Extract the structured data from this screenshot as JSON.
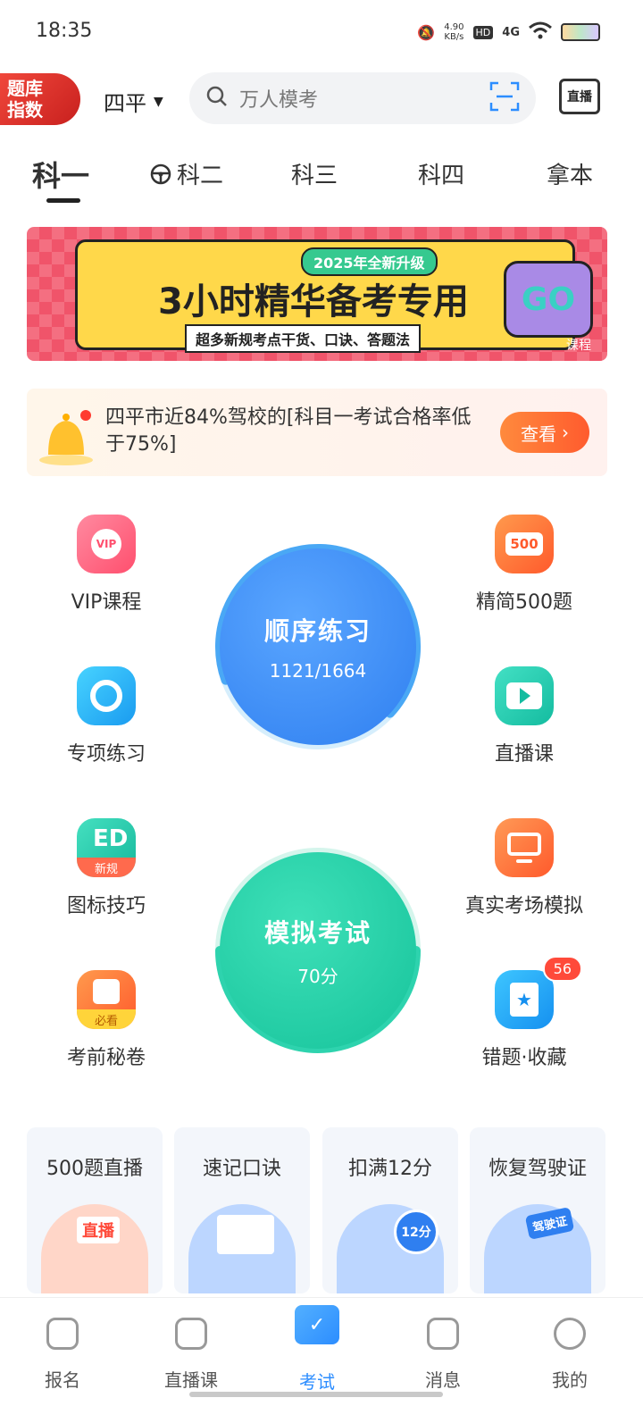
{
  "status": {
    "time": "18:35",
    "net_speed": "4.90",
    "net_unit": "KB/s",
    "hd": "HD",
    "signal": "4G"
  },
  "header": {
    "index_badge_line1": "题库",
    "index_badge_line2": "指数",
    "city": "四平",
    "search_placeholder": "万人模考",
    "live_label": "直播"
  },
  "tabs": [
    "科一",
    "科二",
    "科三",
    "科四",
    "拿本"
  ],
  "banner": {
    "pill": "2025年全新升级",
    "title": "3小时精华备考专用",
    "subtitle": "超多新规考点干货、口诀、答题法",
    "go": "GO",
    "tag": "课程"
  },
  "notice": {
    "text": "四平市近84%驾校的[科目一考试合格率低于75%]",
    "button": "查看"
  },
  "features": {
    "vip": "VIP课程",
    "jingjian": "精简500题",
    "jingjian_icon_text": "500",
    "zhuanxiang": "专项练习",
    "zhibo": "直播课",
    "tubiao": "图标技巧",
    "tubiao_tag": "新规",
    "zhenshi": "真实考场模拟",
    "miquan": "考前秘卷",
    "miquan_tag": "必看",
    "cuoti": "错题·收藏",
    "cuoti_badge": "56"
  },
  "practice": {
    "title": "顺序练习",
    "progress_text": "1121/1664",
    "progress_fraction": 0.674
  },
  "exam": {
    "title": "模拟考试",
    "score": "70分"
  },
  "cards": [
    {
      "title": "500题直播",
      "art_text": "直播"
    },
    {
      "title": "速记口诀"
    },
    {
      "title": "扣满12分",
      "art_text": "12分"
    },
    {
      "title": "恢复驾驶证",
      "art_text": "驾驶证"
    }
  ],
  "nav": [
    "报名",
    "直播课",
    "考试",
    "消息",
    "我的"
  ],
  "colors": {
    "accent": "#2c8dff",
    "practice_blue": "#3a8ef3",
    "exam_green": "#20cfa6",
    "orange": "#ff6a33"
  }
}
